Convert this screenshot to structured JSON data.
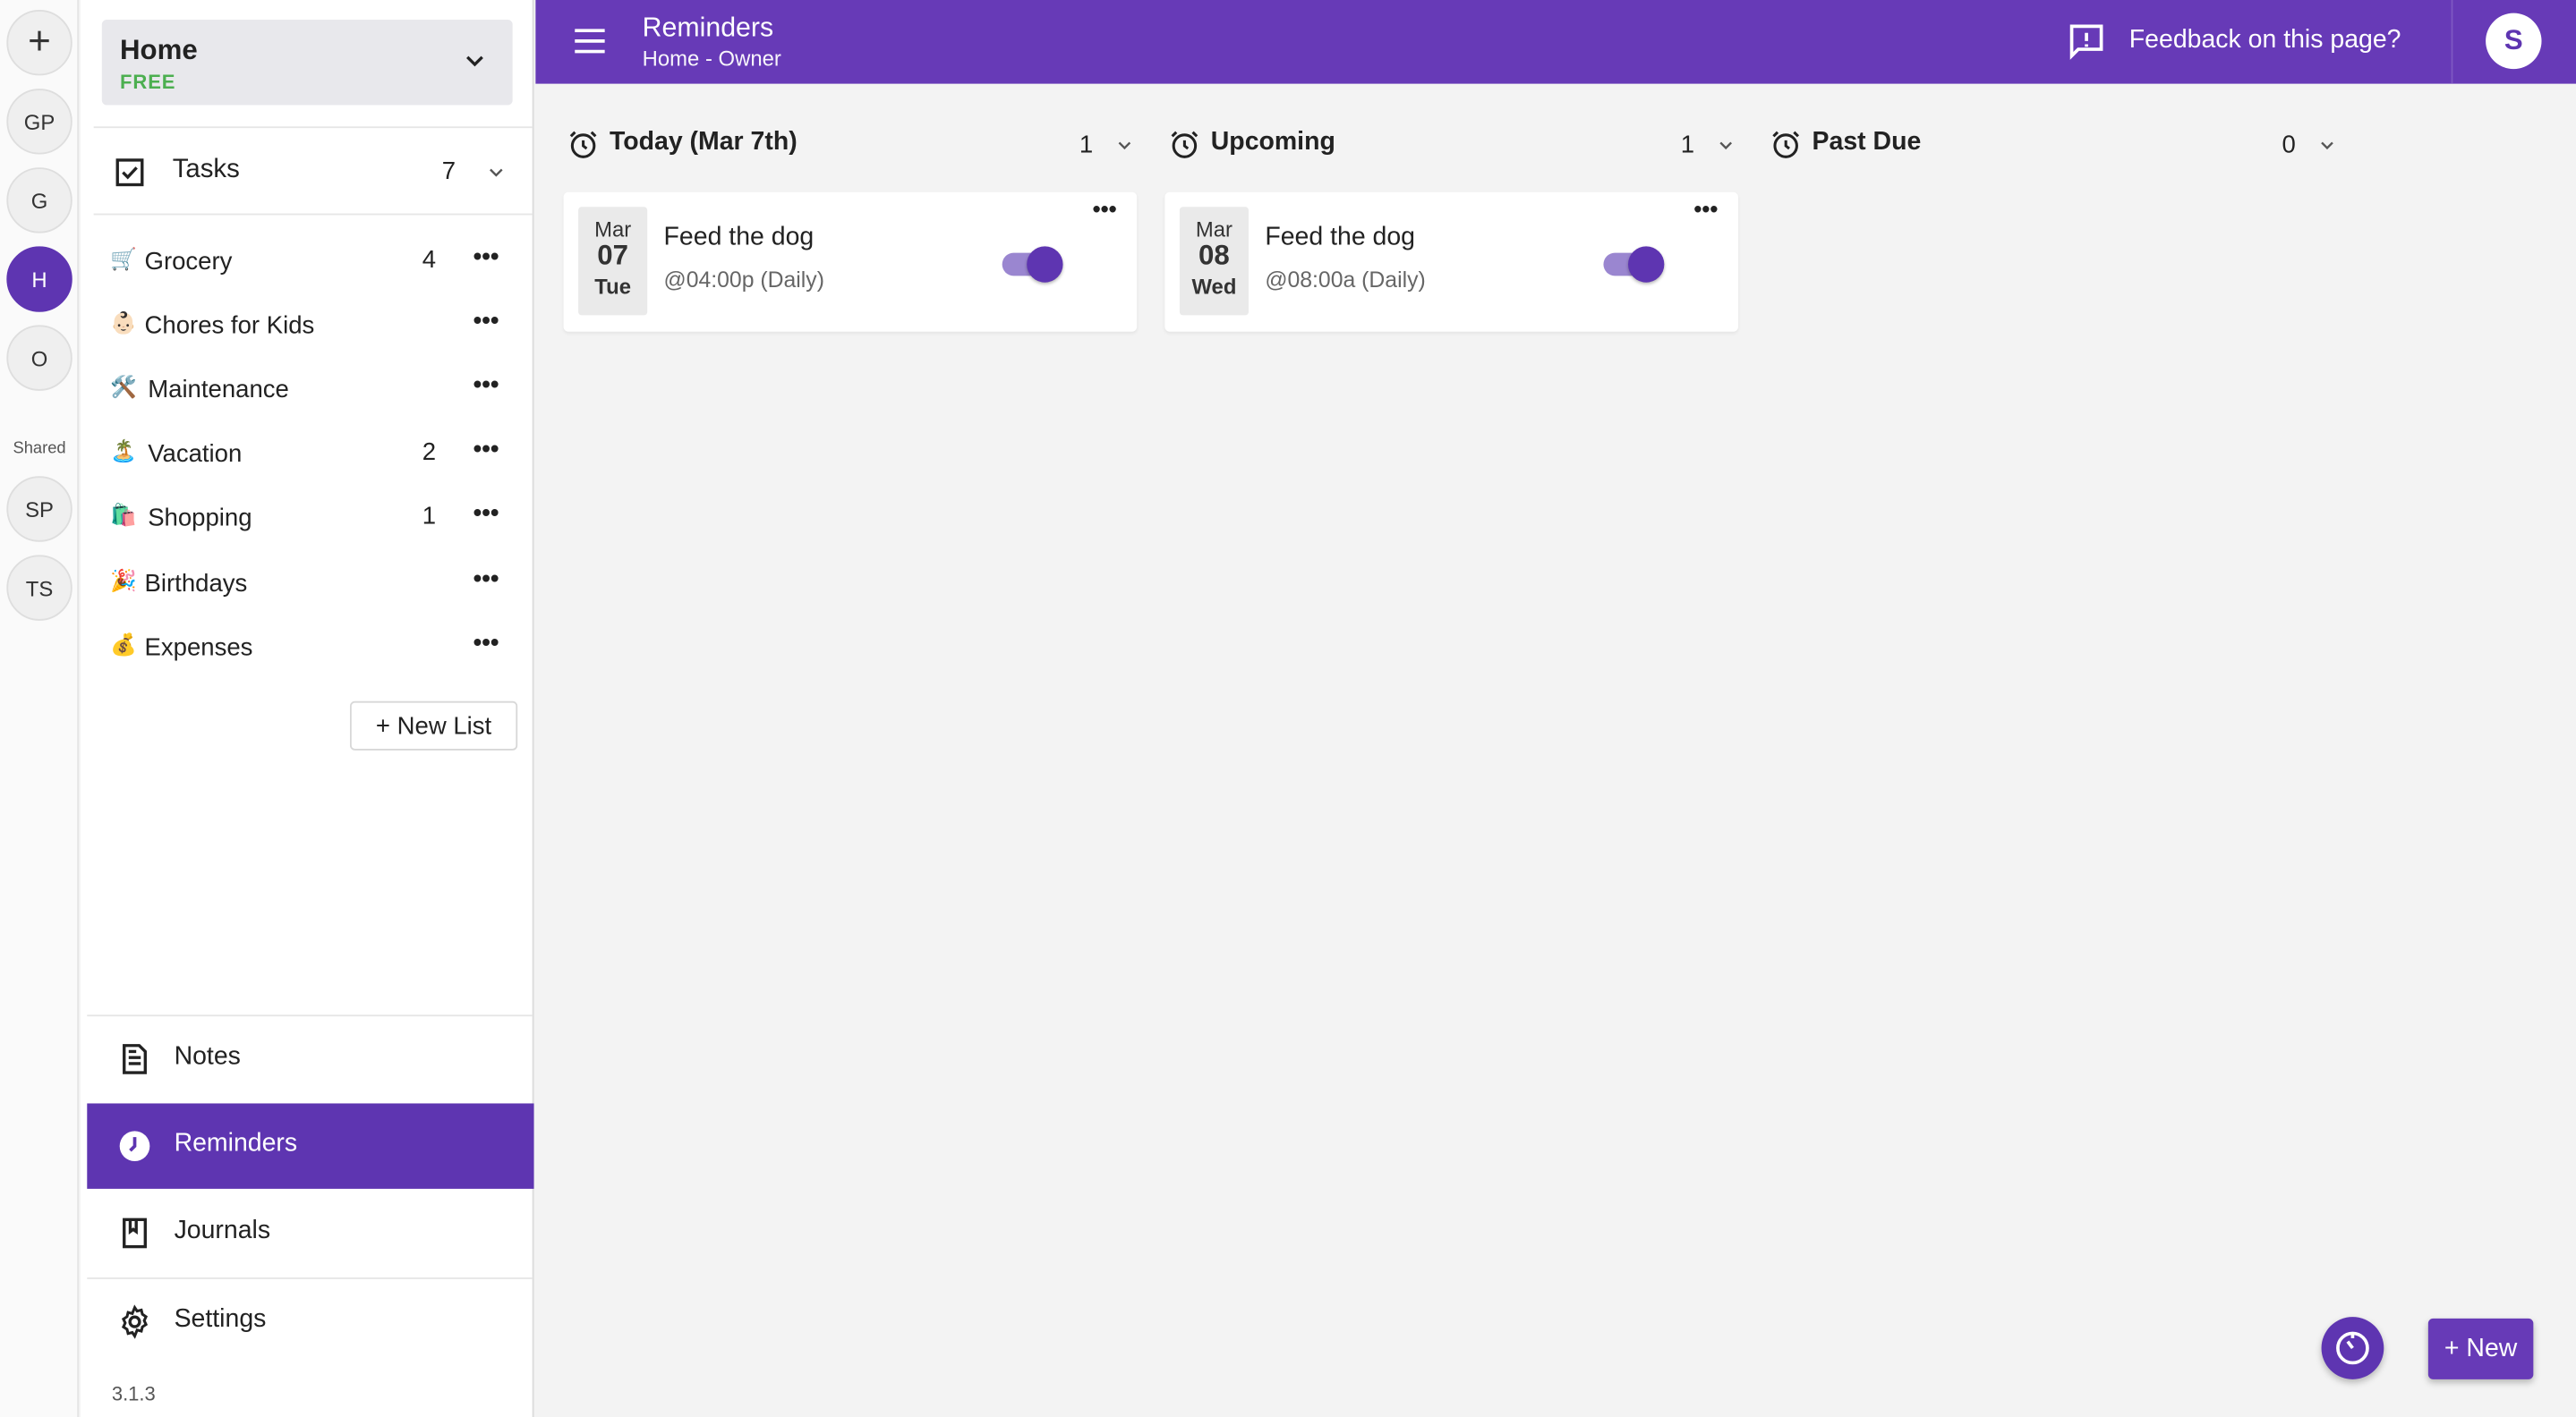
{
  "rail": {
    "add_label": "+",
    "workspaces": [
      "GP",
      "G",
      "H",
      "O"
    ],
    "shared_label": "Shared",
    "shared": [
      "SP",
      "TS"
    ]
  },
  "workspace": {
    "name": "Home",
    "plan": "FREE"
  },
  "tasks": {
    "label": "Tasks",
    "count": "7"
  },
  "lists": [
    {
      "emoji": "🛒",
      "name": "Grocery",
      "count": "4"
    },
    {
      "emoji": "👶🏻",
      "name": "Chores for Kids",
      "count": ""
    },
    {
      "emoji": "🛠️",
      "name": "Maintenance",
      "count": ""
    },
    {
      "emoji": "🏝️",
      "name": "Vacation",
      "count": "2"
    },
    {
      "emoji": "🛍️",
      "name": "Shopping",
      "count": "1"
    },
    {
      "emoji": "🎉",
      "name": "Birthdays",
      "count": ""
    },
    {
      "emoji": "💰",
      "name": "Expenses",
      "count": ""
    }
  ],
  "new_list_label": "+ New List",
  "nav": {
    "notes": "Notes",
    "reminders": "Reminders",
    "journals": "Journals",
    "settings": "Settings"
  },
  "version": "3.1.3",
  "header": {
    "title": "Reminders",
    "subtitle": "Home - Owner",
    "feedback": "Feedback on this page?",
    "avatar": "S"
  },
  "columns": [
    {
      "title": "Today (Mar 7th)",
      "count": "1",
      "card": {
        "month": "Mar",
        "day": "07",
        "weekday": "Tue",
        "title": "Feed the dog",
        "schedule": "@04:00p (Daily)",
        "enabled": true
      }
    },
    {
      "title": "Upcoming",
      "count": "1",
      "card": {
        "month": "Mar",
        "day": "08",
        "weekday": "Wed",
        "title": "Feed the dog",
        "schedule": "@08:00a (Daily)",
        "enabled": true
      }
    },
    {
      "title": "Past Due",
      "count": "0"
    }
  ],
  "fab": {
    "new_label": "+ New"
  },
  "colors": {
    "primary": "#673ab7",
    "primary_dark": "#5e35b1",
    "plan_green": "#4caf50"
  }
}
